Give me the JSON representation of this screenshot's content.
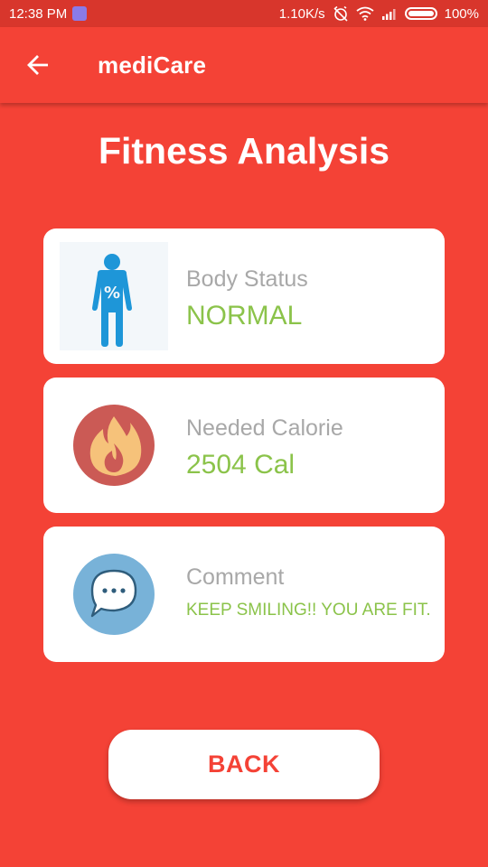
{
  "status_bar": {
    "time": "12:38 PM",
    "network_speed": "1.10K/s",
    "battery": "100%"
  },
  "app_bar": {
    "title": "mediCare"
  },
  "page": {
    "title": "Fitness Analysis"
  },
  "cards": [
    {
      "label": "Body Status",
      "value": "NORMAL",
      "icon": "body-percent-icon"
    },
    {
      "label": "Needed Calorie",
      "value": "2504 Cal",
      "icon": "flame-icon"
    },
    {
      "label": "Comment",
      "value": "KEEP SMILING!! YOU ARE FIT.",
      "icon": "chat-bubble-icon"
    }
  ],
  "actions": {
    "back_label": "BACK"
  },
  "colors": {
    "primary": "#f44236",
    "status_bar": "#d8362c",
    "value_green": "#8bc34a",
    "label_gray": "#a8a8a8"
  }
}
